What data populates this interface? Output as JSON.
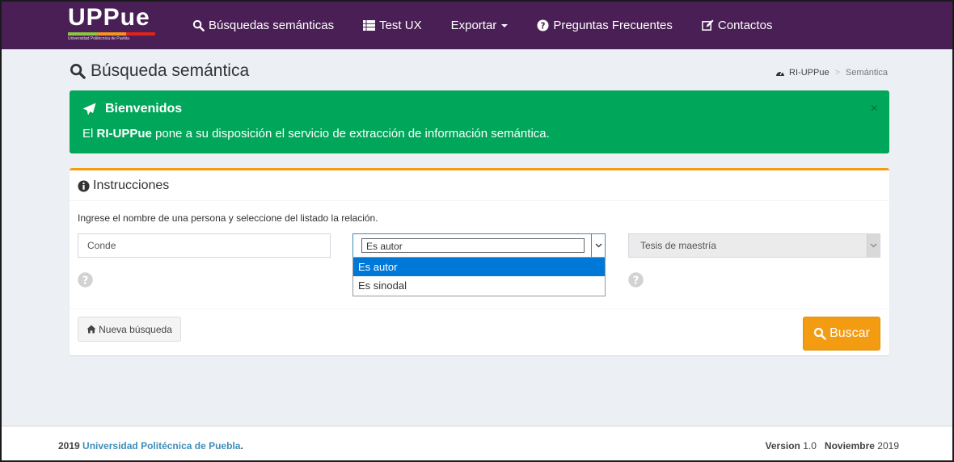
{
  "navbar": {
    "logo": {
      "title": "UPPue",
      "subtitle": "Universidad Politécnica de Puebla",
      "colors": [
        "#8dc63f",
        "#f7941d",
        "#e2231a"
      ]
    },
    "items": [
      {
        "label": "Búsquedas semánticas",
        "icon": "search-icon"
      },
      {
        "label": "Test UX",
        "icon": "list-icon"
      },
      {
        "label": "Exportar",
        "icon": "caret-down-icon"
      },
      {
        "label": "Preguntas Frecuentes",
        "icon": "question-circle-icon"
      },
      {
        "label": "Contactos",
        "icon": "edit-icon"
      }
    ],
    "bg_color": "#4a1f55"
  },
  "header": {
    "title": "Búsqueda semántica",
    "breadcrumb": {
      "home": "RI-UPPue",
      "current": "Semántica"
    }
  },
  "alert": {
    "title": "Bienvenidos",
    "body_prefix": "El ",
    "body_bold": "RI-UPPue",
    "body_suffix": " pone a su disposición el servicio de extracción de información semántica.",
    "close": "×",
    "color": "#00a65a"
  },
  "box": {
    "title": "Instrucciones",
    "instruction": "Ingrese el nombre de una persona y seleccione del listado la relación.",
    "name_input": {
      "value": "Conde"
    },
    "relation_select": {
      "value": "Es autor",
      "options": [
        "Es autor",
        "Es sinodal"
      ]
    },
    "type_select": {
      "value": "Tesis de maestría"
    },
    "new_search_label": "Nueva búsqueda",
    "search_label": "Buscar",
    "accent_color": "#f39c12"
  },
  "footer": {
    "year": "2019",
    "university": "Universidad Politécnica de Puebla",
    "period": ".",
    "version_label": "Version",
    "version": "1.0",
    "date_month": "Noviembre",
    "date_year": "2019"
  }
}
